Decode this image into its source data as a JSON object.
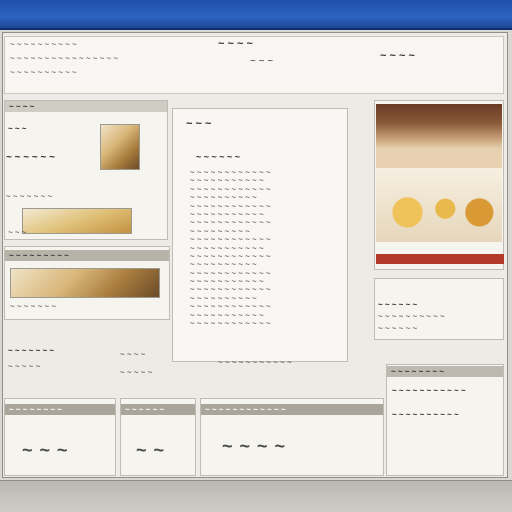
{
  "window": {
    "title": ""
  },
  "header": {
    "line1": "~ ~ ~ ~ ~ ~ ~ ~ ~ ~",
    "line2": "~ ~ ~ ~ ~ ~ ~ ~ ~ ~ ~ ~ ~ ~ ~ ~",
    "line3": "~ ~ ~ ~ ~ ~ ~ ~ ~ ~",
    "center_title": "~ ~ ~ ~",
    "center_sub": "~ ~ ~",
    "right_label": "~ ~ ~ ~"
  },
  "left_panel": {
    "head": "~ ~ ~ ~",
    "subhead": "~ ~ ~",
    "caption1": "~ ~ ~ ~ ~ ~",
    "caption2": "~ ~ ~ ~ ~ ~ ~",
    "caption3": "~ ~ ~"
  },
  "left_mid": {
    "head": "~ ~ ~ ~ ~ ~ ~ ~ ~",
    "caption": "~ ~ ~ ~ ~ ~ ~"
  },
  "left_lower": {
    "line1": "~ ~ ~ ~ ~ ~ ~",
    "line2": "~ ~ ~ ~ ~",
    "side1": "~ ~ ~ ~",
    "side2": "~ ~ ~ ~ ~"
  },
  "center_panel": {
    "head": "~ ~ ~",
    "subhead": "~ ~ ~ ~ ~ ~",
    "lines": [
      "~ ~ ~ ~ ~ ~ ~ ~ ~ ~ ~ ~",
      "~ ~ ~ ~ ~ ~ ~ ~ ~ ~ ~",
      "~ ~ ~ ~ ~ ~ ~ ~ ~ ~ ~ ~",
      "~ ~ ~ ~ ~ ~ ~ ~ ~ ~",
      "~ ~ ~ ~ ~ ~ ~ ~ ~ ~ ~ ~",
      "~ ~ ~ ~ ~ ~ ~ ~ ~ ~ ~",
      "~ ~ ~ ~ ~ ~ ~ ~ ~ ~ ~ ~",
      "~ ~ ~ ~ ~ ~ ~ ~ ~",
      "~ ~ ~ ~ ~ ~ ~ ~ ~ ~ ~ ~",
      "~ ~ ~ ~ ~ ~ ~ ~ ~ ~ ~",
      "~ ~ ~ ~ ~ ~ ~ ~ ~ ~ ~ ~",
      "~ ~ ~ ~ ~ ~ ~ ~ ~ ~",
      "~ ~ ~ ~ ~ ~ ~ ~ ~ ~ ~ ~",
      "~ ~ ~ ~ ~ ~ ~ ~ ~ ~ ~",
      "~ ~ ~ ~ ~ ~ ~ ~ ~ ~ ~ ~",
      "~ ~ ~ ~ ~ ~ ~ ~ ~ ~",
      "~ ~ ~ ~ ~ ~ ~ ~ ~ ~ ~ ~",
      "~ ~ ~ ~ ~ ~ ~ ~ ~ ~ ~",
      "~ ~ ~ ~ ~ ~ ~ ~ ~ ~ ~ ~"
    ],
    "footer": "~ ~ ~ ~ ~ ~ ~ ~ ~ ~ ~"
  },
  "right_panel": {
    "info1": "~ ~ ~ ~ ~ ~",
    "info2": "~ ~ ~ ~ ~ ~ ~ ~ ~ ~",
    "info3": "~ ~ ~ ~ ~ ~"
  },
  "bottom_row": {
    "tab1": "~ ~ ~ ~ ~ ~ ~ ~",
    "tab2": "~ ~ ~ ~ ~ ~",
    "tab3": "~ ~ ~ ~ ~ ~ ~ ~ ~ ~ ~ ~",
    "value1": "~ ~ ~",
    "value2": "~ ~",
    "value3": "~ ~ ~ ~",
    "right_head": "~ ~ ~ ~ ~ ~ ~ ~",
    "right_line1": "~ ~ ~ ~ ~ ~ ~ ~ ~ ~ ~",
    "right_line2": "~ ~ ~ ~ ~ ~ ~ ~ ~ ~"
  },
  "colors": {
    "title_bar": "#2d63c0",
    "window_bg": "#ecebe6",
    "panel_head": "#cfccc4",
    "accent_red": "#b33a2a"
  },
  "icons": [
    "food-photo-thumbnail",
    "food-photo-main"
  ]
}
